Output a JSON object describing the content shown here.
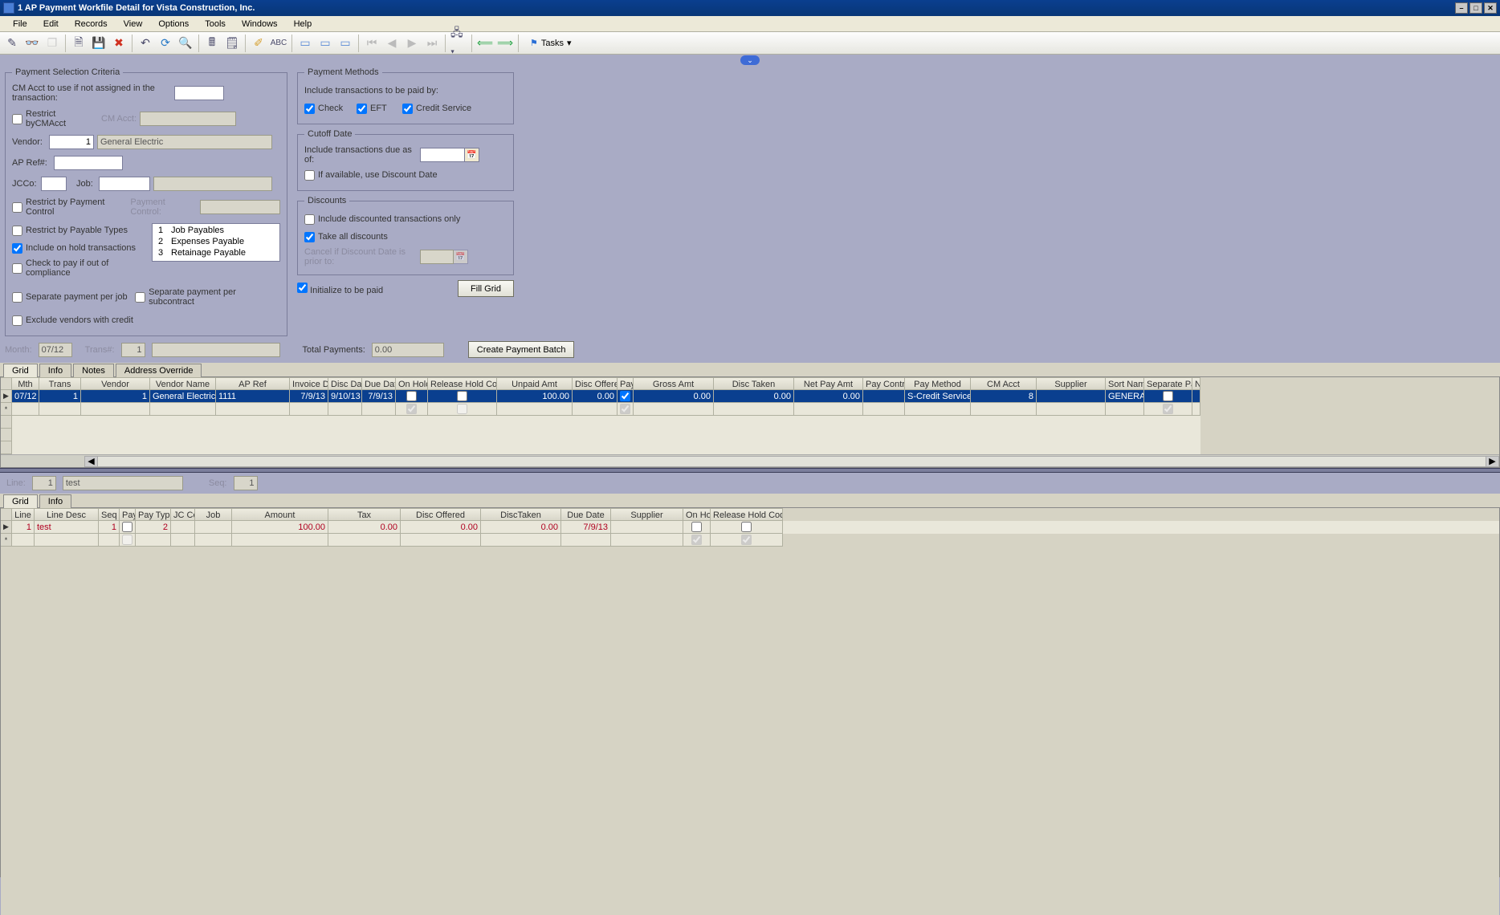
{
  "title": "1 AP Payment Workfile Detail for Vista Construction, Inc.",
  "menus": [
    "File",
    "Edit",
    "Records",
    "View",
    "Options",
    "Tools",
    "Windows",
    "Help"
  ],
  "toolbar": {
    "tasks_label": "Tasks"
  },
  "criteria": {
    "legend": "Payment Selection Criteria",
    "cm_acct_label": "CM Acct to use if not assigned in the transaction:",
    "cm_acct_value": "",
    "restrict_cmacct_label": "Restrict byCMAcct",
    "cmacct_field_label": "CM Acct:",
    "cmacct_field_value": "",
    "vendor_label": "Vendor:",
    "vendor_value": "1",
    "vendor_name": "General Electric",
    "apref_label": "AP Ref#:",
    "apref_value": "",
    "jcco_label": "JCCo:",
    "jcco_value": "",
    "job_label": "Job:",
    "job_value": "",
    "job_desc": "",
    "restrict_paycontrol_label": "Restrict by Payment Control",
    "paycontrol_field_label": "Payment Control:",
    "paycontrol_value": "",
    "restrict_paytypes_label": "Restrict by Payable Types",
    "payable_types": [
      {
        "n": "1",
        "d": "Job Payables"
      },
      {
        "n": "2",
        "d": "Expenses Payable"
      },
      {
        "n": "3",
        "d": "Retainage Payable"
      }
    ],
    "include_onhold_label": "Include on hold transactions",
    "check_compliance_label": "Check to pay if out of compliance",
    "sep_per_job_label": "Separate payment per job",
    "sep_per_sub_label": "Separate payment per subcontract",
    "exclude_credit_label": "Exclude vendors with credit"
  },
  "paymethods": {
    "legend": "Payment Methods",
    "include_label": "Include transactions to be paid by:",
    "check": "Check",
    "eft": "EFT",
    "cs": "Credit Service"
  },
  "cutoff": {
    "legend": "Cutoff Date",
    "include_label": "Include transactions due as of:",
    "value": "",
    "discount_label": "If available, use Discount Date"
  },
  "discounts": {
    "legend": "Discounts",
    "include_only_label": "Include discounted transactions only",
    "take_all_label": "Take all discounts",
    "cancel_label": "Cancel if Discount Date is prior to:",
    "cancel_value": ""
  },
  "initialize_label": "Initialize to be paid",
  "fill_grid_btn": "Fill Grid",
  "summary": {
    "month_label": "Month:",
    "month_value": "07/12",
    "trans_label": "Trans#:",
    "trans_value": "1",
    "trans_desc": "",
    "total_label": "Total Payments:",
    "total_value": "0.00",
    "create_btn": "Create Payment Batch"
  },
  "tabs1": [
    "Grid",
    "Info",
    "Notes",
    "Address Override"
  ],
  "grid1": {
    "headers": [
      "Mth",
      "Trans",
      "Vendor",
      "Vendor Name",
      "AP Ref",
      "Invoice Date",
      "Disc Date",
      "Due Date",
      "On Hold",
      "Release Hold Code",
      "Unpaid Amt",
      "Disc Offered",
      "Pay",
      "Gross Amt",
      "Disc Taken",
      "Net Pay Amt",
      "Pay Control",
      "Pay Method",
      "CM Acct",
      "Supplier",
      "Sort Name",
      "Separate Pay",
      "N"
    ],
    "widths": [
      34,
      52,
      86,
      82,
      92,
      48,
      42,
      42,
      40,
      86,
      94,
      56,
      20,
      100,
      100,
      86,
      52,
      82,
      82,
      86,
      48,
      60,
      10
    ],
    "row": {
      "mth": "07/12",
      "trans": "1",
      "vendor": "1",
      "vendor_name": "General Electric",
      "apref": "1111",
      "inv_date": "7/9/13",
      "disc_date": "9/10/13",
      "due_date": "7/9/13",
      "on_hold": false,
      "rhc": false,
      "unpaid": "100.00",
      "disc_off": "0.00",
      "pay": true,
      "gross": "0.00",
      "disc_taken": "0.00",
      "net": "0.00",
      "pay_control": "",
      "pay_method": "S-Credit Service",
      "cm_acct": "8",
      "supplier": "",
      "sort_name": "GENERALELI",
      "sep_pay": false
    }
  },
  "linehdr": {
    "line_label": "Line:",
    "line_value": "1",
    "desc_value": "test",
    "seq_label": "Seq:",
    "seq_value": "1"
  },
  "tabs2": [
    "Grid",
    "Info"
  ],
  "grid2": {
    "headers": [
      "Line",
      "Line Desc",
      "Seq",
      "Pay",
      "Pay Type",
      "JC Co",
      "Job",
      "Amount",
      "Tax",
      "Disc Offered",
      "DiscTaken",
      "Due Date",
      "Supplier",
      "On Hold",
      "Release Hold Code"
    ],
    "widths": [
      28,
      80,
      26,
      20,
      44,
      30,
      46,
      120,
      90,
      100,
      100,
      62,
      90,
      34,
      90
    ],
    "row": {
      "line": "1",
      "line_desc": "test",
      "seq": "1",
      "pay": false,
      "pay_type": "2",
      "jcco": "",
      "job": "",
      "amount": "100.00",
      "tax": "0.00",
      "disc_off": "0.00",
      "disc_taken": "0.00",
      "due": "7/9/13",
      "supplier": "",
      "on_hold": false,
      "rhc": false
    },
    "footer_onhold": true,
    "footer_rhc": true
  }
}
